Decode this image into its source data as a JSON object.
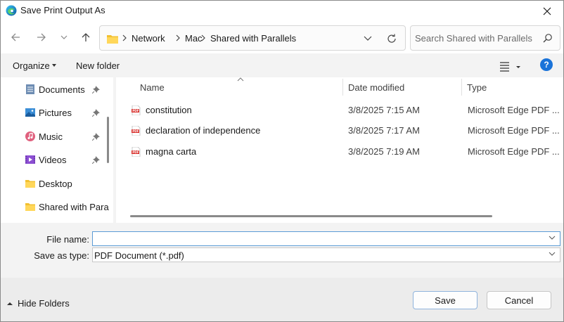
{
  "window": {
    "title": "Save Print Output As",
    "app_icon": "edge-icon",
    "accent": "#1a73d9"
  },
  "address": {
    "breadcrumbs": [
      "Network",
      "Mac",
      "Shared with Parallels"
    ],
    "search_placeholder": "Search Shared with Parallels"
  },
  "toolbar": {
    "organize_label": "Organize",
    "new_folder_label": "New folder",
    "help_label": "?"
  },
  "nav_pane": {
    "items": [
      {
        "label": "Documents",
        "icon": "documents-icon",
        "pinned": true
      },
      {
        "label": "Pictures",
        "icon": "pictures-icon",
        "pinned": true
      },
      {
        "label": "Music",
        "icon": "music-icon",
        "pinned": true
      },
      {
        "label": "Videos",
        "icon": "videos-icon",
        "pinned": true
      },
      {
        "label": "Desktop",
        "icon": "folder-icon",
        "pinned": false
      },
      {
        "label": "Shared with Para",
        "icon": "folder-icon",
        "pinned": false
      }
    ]
  },
  "file_list": {
    "columns": {
      "name": "Name",
      "date": "Date modified",
      "type": "Type"
    },
    "files": [
      {
        "name": "constitution",
        "date": "3/8/2025 7:15 AM",
        "type": "Microsoft Edge PDF ..."
      },
      {
        "name": "declaration of independence",
        "date": "3/8/2025 7:17 AM",
        "type": "Microsoft Edge PDF ..."
      },
      {
        "name": "magna carta",
        "date": "3/8/2025 7:19 AM",
        "type": "Microsoft Edge PDF ..."
      }
    ]
  },
  "form": {
    "file_name_label": "File name:",
    "file_name_value": "",
    "save_as_type_label": "Save as type:",
    "save_as_type_value": "PDF Document (*.pdf)"
  },
  "footer": {
    "hide_folders_label": "Hide Folders",
    "save_label": "Save",
    "cancel_label": "Cancel"
  }
}
